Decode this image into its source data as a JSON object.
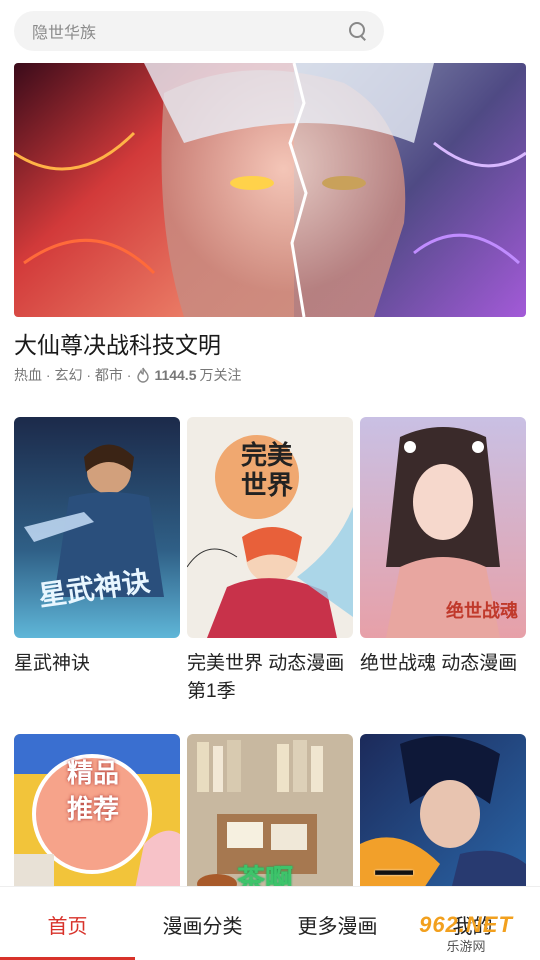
{
  "search": {
    "placeholder": "隐世华族"
  },
  "hero": {
    "title": "大仙尊决战科技文明",
    "tags": "热血 · 玄幻 · 都市 ·",
    "followers": "1144.5",
    "followers_unit": "万关注"
  },
  "cards": [
    {
      "title": "星武神诀",
      "cover_text": "星武神诀"
    },
    {
      "title": "完美世界 动态漫画 第1季",
      "cover_text": "完美世界"
    },
    {
      "title": "绝世战魂 动态漫画",
      "cover_text": "绝世战魂"
    },
    {
      "title": "",
      "cover_text": "精品推荐"
    },
    {
      "title": "",
      "cover_text": "茶啊"
    },
    {
      "title": "",
      "cover_text": "一"
    }
  ],
  "nav": {
    "items": [
      {
        "label": "首页"
      },
      {
        "label": "漫画分类"
      },
      {
        "label": "更多漫画"
      },
      {
        "label": "我的"
      }
    ]
  },
  "watermark": {
    "top": "962.NET",
    "bottom": "乐游网"
  },
  "colors": {
    "accent": "#d8322a"
  }
}
